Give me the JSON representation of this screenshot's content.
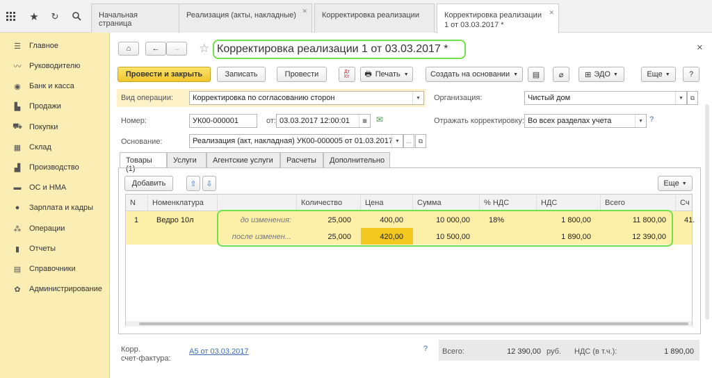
{
  "topbar": {
    "icons": [
      "grid-icon",
      "star-icon",
      "history-icon",
      "search-icon"
    ],
    "tabs": [
      {
        "label": "Начальная страница"
      },
      {
        "label": "Реализация (акты, накладные)"
      },
      {
        "label": "Корректировка реализации"
      },
      {
        "label": "Корректировка реализации\n1 от 03.03.2017 *"
      }
    ]
  },
  "sidebar": {
    "items": [
      {
        "label": "Главное",
        "icon": "menu-icon"
      },
      {
        "label": "Руководителю",
        "icon": "chart-trend-icon"
      },
      {
        "label": "Банк и касса",
        "icon": "coin-icon"
      },
      {
        "label": "Продажи",
        "icon": "bag-icon"
      },
      {
        "label": "Покупки",
        "icon": "cart-icon"
      },
      {
        "label": "Склад",
        "icon": "warehouse-icon"
      },
      {
        "label": "Производство",
        "icon": "factory-icon"
      },
      {
        "label": "ОС и НМА",
        "icon": "truck-icon"
      },
      {
        "label": "Зарплата и кадры",
        "icon": "person-icon"
      },
      {
        "label": "Операции",
        "icon": "operations-icon"
      },
      {
        "label": "Отчеты",
        "icon": "report-icon"
      },
      {
        "label": "Справочники",
        "icon": "book-icon"
      },
      {
        "label": "Администрирование",
        "icon": "gear-icon"
      }
    ]
  },
  "doc": {
    "title": "Корректировка реализации 1 от 03.03.2017 *",
    "close": "×",
    "toolbar": {
      "post_close": "Провести и закрыть",
      "save": "Записать",
      "post": "Провести",
      "dtkt": "Дт\nКт",
      "print": "Печать",
      "create_based": "Создать на основании",
      "edo": "ЭДО",
      "more": "Еще",
      "help": "?"
    },
    "form": {
      "op_label": "Вид операции:",
      "op_value": "Корректировка по согласованию сторон",
      "org_label": "Организация:",
      "org_value": "Чистый дом",
      "num_label": "Номер:",
      "num_value": "УК00-000001",
      "date_label": "от:",
      "date_value": "03.03.2017 12:00:01",
      "reflect_label": "Отражать корректировку:",
      "reflect_value": "Во всех разделах учета",
      "reflect_help": "?",
      "basis_label": "Основание:",
      "basis_value": "Реализация (акт, накладная) УК00-000005 от 01.03.2017"
    },
    "tabs": [
      "Товары (1)",
      "Услуги",
      "Агентские услуги",
      "Расчеты",
      "Дополнительно"
    ],
    "table": {
      "add": "Добавить",
      "more": "Еще",
      "headers": [
        "N",
        "Номенклатура",
        "",
        "Количество",
        "Цена",
        "Сумма",
        "% НДС",
        "НДС",
        "Всего",
        "Сч"
      ],
      "row": {
        "n": "1",
        "item": "Ведро 10л",
        "before": {
          "state": "до изменения:",
          "qty": "25,000",
          "price": "400,00",
          "sum": "10 000,00",
          "vat_rate": "18%",
          "vat": "1 800,00",
          "total": "11 800,00",
          "acc": "41."
        },
        "after": {
          "state": "после изменен...",
          "qty": "25,000",
          "price": "420,00",
          "sum": "10 500,00",
          "vat_rate": "",
          "vat": "1 890,00",
          "total": "12 390,00"
        }
      }
    },
    "footer": {
      "invoice_label": "Корр.\nсчет-фактура:",
      "invoice_link": "А5 от 03.03.2017",
      "help": "?",
      "total_label": "Всего:",
      "total_value": "12 390,00",
      "currency": "руб.",
      "vat_label": "НДС (в т.ч.):",
      "vat_value": "1 890,00"
    }
  }
}
